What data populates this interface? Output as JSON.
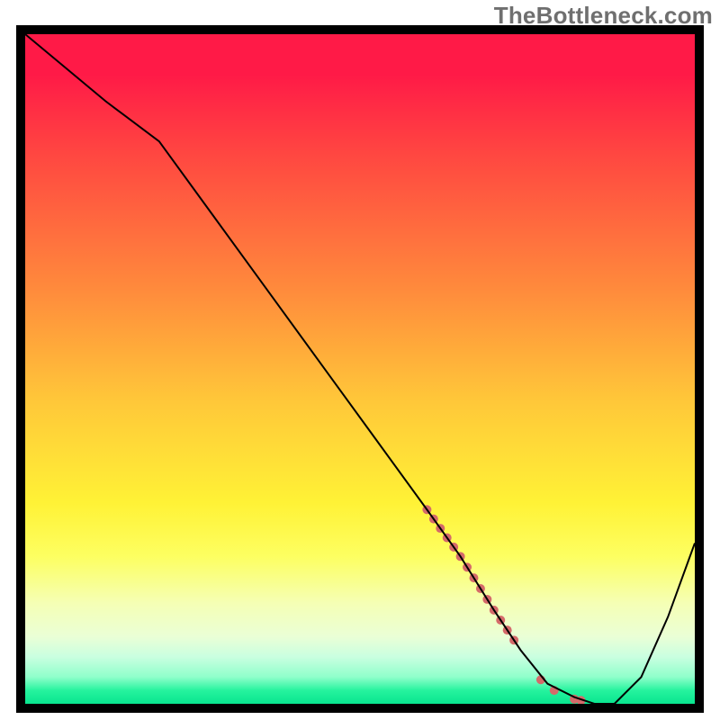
{
  "watermark": "TheBottleneck.com",
  "chart_data": {
    "type": "line",
    "title": "",
    "xlabel": "",
    "ylabel": "",
    "xlim": [
      0,
      100
    ],
    "ylim": [
      0,
      100
    ],
    "grid": false,
    "legend": false,
    "background_gradient": {
      "top_color": "#ff1a47",
      "bottom_color": "#08e58f",
      "description": "vertical red→orange→yellow→green heat gradient"
    },
    "series": [
      {
        "name": "bottleneck_curve",
        "color": "#000000",
        "stroke_width": 2,
        "x": [
          0,
          12,
          20,
          28,
          36,
          44,
          52,
          60,
          65,
          70,
          74,
          78,
          82,
          85,
          88,
          92,
          96,
          100
        ],
        "y": [
          100,
          90,
          84,
          73,
          62,
          51,
          40,
          29,
          22,
          14,
          8,
          3,
          1,
          0,
          0,
          4,
          13,
          24
        ]
      },
      {
        "name": "highlight_dots",
        "color": "#d46a6a",
        "marker": "circle",
        "marker_size_px": 10,
        "x": [
          60,
          61,
          62,
          63,
          64,
          65,
          66,
          67,
          68,
          69,
          70,
          71,
          72,
          73,
          77,
          79,
          82,
          83
        ],
        "y": [
          29,
          27.6,
          26.2,
          24.8,
          23.4,
          22,
          20.4,
          18.8,
          17.2,
          15.6,
          14,
          12.5,
          11,
          9.5,
          3.6,
          2,
          0.7,
          0.5
        ]
      }
    ]
  }
}
